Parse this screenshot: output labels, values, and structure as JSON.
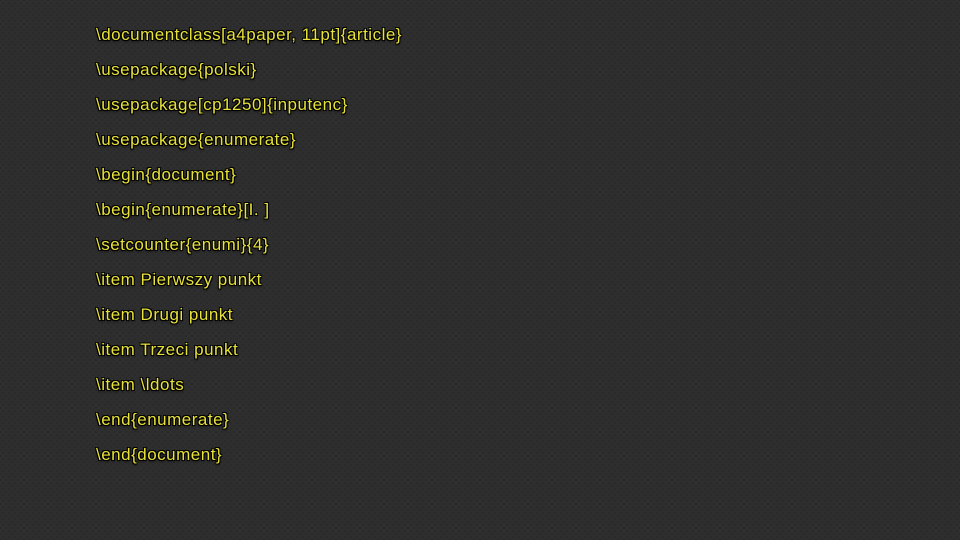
{
  "code": {
    "lines": [
      "\\documentclass[a4paper, 11pt]{article}",
      "\\usepackage{polski}",
      "\\usepackage[cp1250]{inputenc}",
      "\\usepackage{enumerate}",
      "\\begin{document}",
      "\\begin{enumerate}[I. ]",
      "\\setcounter{enumi}{4}",
      "\\item Pierwszy punkt",
      "\\item Drugi punkt",
      "\\item Trzeci punkt",
      "\\item \\ldots",
      "\\end{enumerate}",
      "\\end{document}"
    ]
  }
}
